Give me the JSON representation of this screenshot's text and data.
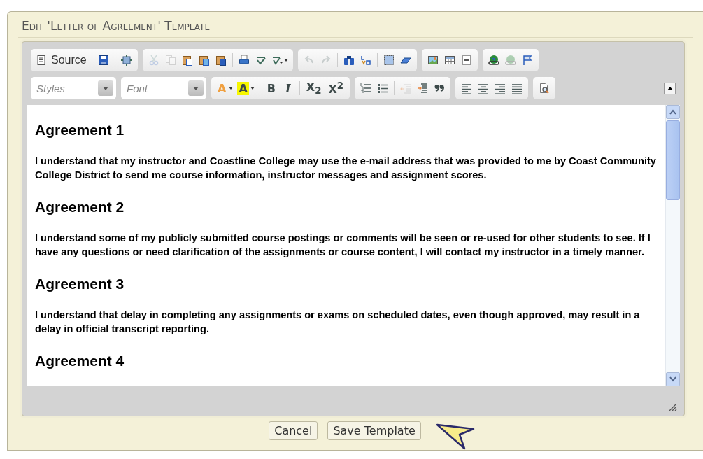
{
  "dialog": {
    "title": "Edit 'Letter of Agreement' Template"
  },
  "toolbar_row_1": [
    {
      "items": [
        {
          "kind": "button",
          "label": "Source",
          "disabled": false
        },
        {
          "kind": "separator"
        },
        {
          "kind": "button",
          "disabled": false
        },
        {
          "kind": "separator"
        },
        {
          "kind": "button",
          "disabled": false
        }
      ]
    },
    {
      "items": [
        {
          "kind": "button",
          "disabled": true
        },
        {
          "kind": "button",
          "disabled": true
        },
        {
          "kind": "button",
          "disabled": false
        },
        {
          "kind": "button",
          "disabled": false
        },
        {
          "kind": "button",
          "disabled": false
        },
        {
          "kind": "separator"
        },
        {
          "kind": "button",
          "disabled": false
        },
        {
          "kind": "button",
          "disabled": false
        },
        {
          "kind": "dropdown",
          "disabled": false
        }
      ]
    },
    {
      "items": [
        {
          "kind": "button",
          "disabled": true
        },
        {
          "kind": "button",
          "disabled": true
        },
        {
          "kind": "separator"
        },
        {
          "kind": "button",
          "disabled": false
        },
        {
          "kind": "button",
          "disabled": false
        },
        {
          "kind": "separator"
        },
        {
          "kind": "button",
          "disabled": false
        },
        {
          "kind": "button",
          "disabled": false
        }
      ]
    },
    {
      "items": [
        {
          "kind": "button",
          "disabled": false
        },
        {
          "kind": "button",
          "disabled": false
        },
        {
          "kind": "button",
          "disabled": false
        }
      ]
    },
    {
      "items": [
        {
          "kind": "button",
          "disabled": false
        },
        {
          "kind": "button",
          "disabled": true
        },
        {
          "kind": "button",
          "disabled": false
        }
      ]
    }
  ],
  "combos": [
    {
      "placeholder": "Styles"
    },
    {
      "placeholder": "Font"
    }
  ],
  "toolbar_row_2": [
    {
      "items": [
        {
          "kind": "dropdown",
          "text": "A",
          "disabled": false
        },
        {
          "kind": "dropdown",
          "text": "A",
          "disabled": false
        },
        {
          "kind": "separator"
        },
        {
          "kind": "button",
          "text": "B",
          "disabled": false
        },
        {
          "kind": "button",
          "text": "I",
          "disabled": false
        },
        {
          "kind": "separator"
        },
        {
          "kind": "button",
          "text": "X$_{2}$",
          "disabled": false
        },
        {
          "kind": "button",
          "text": "X$^{2}$",
          "disabled": false
        }
      ]
    },
    {
      "items": [
        {
          "kind": "button",
          "disabled": false
        },
        {
          "kind": "button",
          "disabled": false
        },
        {
          "kind": "separator"
        },
        {
          "kind": "button",
          "disabled": true
        },
        {
          "kind": "button",
          "disabled": false
        },
        {
          "kind": "button",
          "disabled": false
        }
      ]
    },
    {
      "items": [
        {
          "kind": "button",
          "disabled": false
        },
        {
          "kind": "button",
          "disabled": false
        },
        {
          "kind": "button",
          "disabled": false
        },
        {
          "kind": "button",
          "disabled": false
        }
      ]
    },
    {
      "items": [
        {
          "kind": "button",
          "disabled": false
        }
      ]
    }
  ],
  "content": [
    {
      "kind": "heading",
      "text": "Agreement 1"
    },
    {
      "kind": "paragraph",
      "text": "I understand that my instructor and Coastline College may use the e-mail address that was provided to me by Coast Community College District to send me course information, instructor messages and assignment scores."
    },
    {
      "kind": "heading",
      "text": "Agreement 2"
    },
    {
      "kind": "paragraph",
      "text": "I understand some of my publicly submitted course postings or comments will be seen or re-used for other students to see. If I have any questions or need clarification of the assignments or course content, I will contact my instructor in a timely manner."
    },
    {
      "kind": "heading",
      "text": "Agreement 3"
    },
    {
      "kind": "paragraph",
      "text": "I understand that delay in completing any assignments or exams on scheduled dates, even though approved, may result in a delay in official transcript reporting."
    },
    {
      "kind": "heading",
      "text": "Agreement 4"
    }
  ],
  "buttons": [
    {
      "label": "Cancel"
    },
    {
      "label": "Save Template"
    }
  ]
}
